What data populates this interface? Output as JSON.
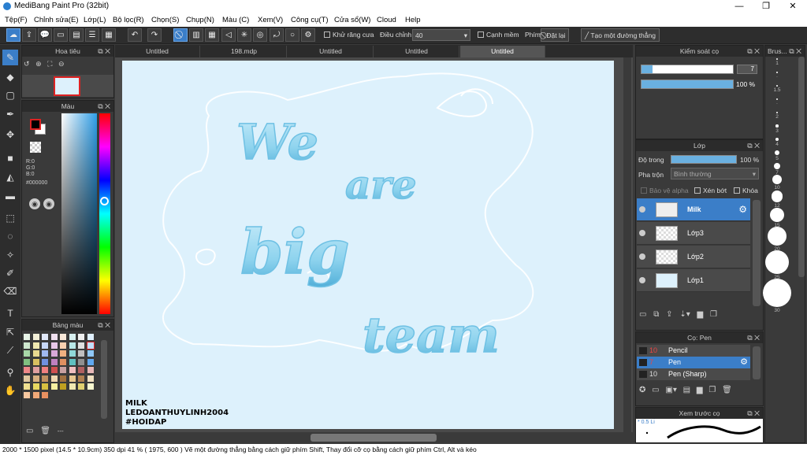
{
  "app": {
    "title": "MediBang Paint Pro (32bit)",
    "minimize": "—",
    "maximize": "❐",
    "close": "✕"
  },
  "menu": [
    "Tệp(F)",
    "Chỉnh sửa(E)",
    "Lớp(L)",
    "Bộ lọc(R)",
    "Chọn(S)",
    "Chụp(N)",
    "Màu (C)",
    "Xem(V)",
    "Công cụ(T)",
    "Cửa sổ(W)",
    "Cloud",
    "Help"
  ],
  "toolbar": {
    "antialias": "Khử răng cưa",
    "adjust_label": "Điều chỉnh",
    "adjust_value": "40",
    "edge": "Cạnh mềm",
    "key_label": "Phím",
    "reset": "Đặt lại",
    "create_line": "Tạo một đường thẳng"
  },
  "navigator": {
    "title": "Hoa tiêu"
  },
  "color": {
    "title": "Màu",
    "r": "R:0",
    "g": "G:0",
    "b": "B:0",
    "hex": "#000000"
  },
  "palette": {
    "title": "Bảng màu",
    "footer": "---"
  },
  "tabs": [
    "Untitled",
    "198.mdp",
    "Untitled",
    "Untitled",
    "Untitled"
  ],
  "canvas": {
    "words": [
      "We",
      "are",
      "big",
      "team"
    ],
    "sig1": "MILK",
    "sig2": "LEDOANTHUYLINH2004",
    "sig3": "#HOIDAP"
  },
  "brush_control": {
    "title": "Kiểm soát cọ",
    "size": "7",
    "opacity": "100 %",
    "opacity_fill": 1.0,
    "size_fill": 0.12
  },
  "layers": {
    "title": "Lớp",
    "opacity_label": "Độ trong",
    "opacity_value": "100 %",
    "blend_label": "Pha trộn",
    "blend_value": "Bình thường",
    "protect_alpha": "Bảo vệ alpha",
    "clip": "Xén bớt",
    "lock": "Khóa",
    "items": [
      "Milk",
      "Lớp3",
      "Lớp2",
      "Lớp1"
    ]
  },
  "brushes": {
    "title": "Cọ: Pen",
    "items": [
      {
        "size": "10",
        "name": "Pencil"
      },
      {
        "size": "7",
        "name": "Pen"
      },
      {
        "size": "10",
        "name": "Pen (Sharp)"
      }
    ]
  },
  "preview": {
    "title": "Xem trước cọ",
    "label": "* 0.5 Li"
  },
  "brush_sizes": {
    "title": "Brus...",
    "items": [
      "1",
      "·",
      "1.5",
      "·",
      "2",
      "3",
      "4",
      "5",
      "7",
      "10",
      "12",
      "15",
      "20",
      "25",
      "30"
    ]
  },
  "status": "2000 * 1500 pixel  (14.5 * 10.9cm)  350 dpi  41 %  ( 1975, 600 )  Vẽ một đường thẳng bằng cách giữ phím Shift, Thay đổi cỡ cọ bằng cách giữ phím Ctrl, Alt và kéo",
  "colors": {
    "accent": "#3b7ec8",
    "canvas_bg": "#ddf1fc",
    "letter": "#8ed3ee"
  }
}
